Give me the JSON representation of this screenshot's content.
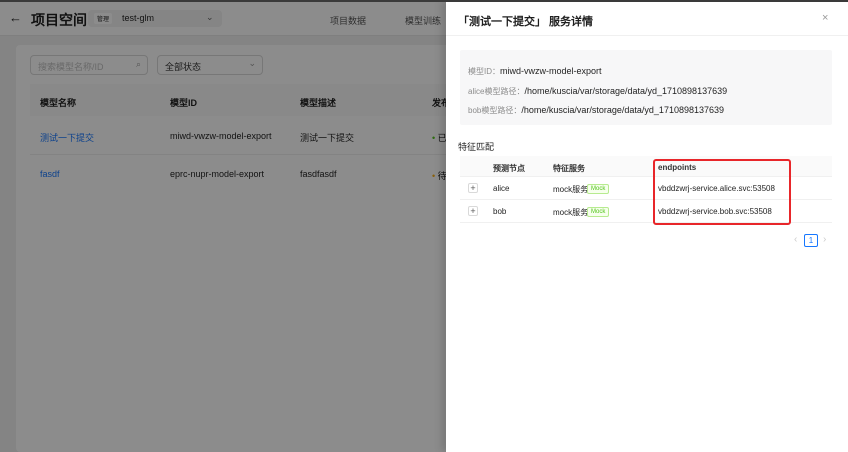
{
  "header": {
    "title": "项目空间",
    "project_tag": "管理",
    "project_name": "test-glm",
    "nav": [
      "项目数据",
      "模型训练"
    ]
  },
  "filters": {
    "search_placeholder": "搜索模型名称/ID",
    "status_select": "全部状态"
  },
  "table": {
    "columns": [
      "模型名称",
      "模型ID",
      "模型描述",
      "发布"
    ],
    "rows": [
      {
        "name": "测试一下提交",
        "id": "miwd-vwzw-model-export",
        "desc": "测试一下提交",
        "status": "已",
        "status_color": "#52c41a"
      },
      {
        "name": "fasdf",
        "id": "eprc-nupr-model-export",
        "desc": "fasdfasdf",
        "status": "待",
        "status_color": "#faad14"
      }
    ]
  },
  "drawer": {
    "title": "「测试一下提交」 服务详情",
    "info": [
      {
        "label": "模型ID：",
        "value": "miwd-vwzw-model-export"
      },
      {
        "label": "alice模型路径：",
        "value": "/home/kuscia/var/storage/data/yd_1710898137639"
      },
      {
        "label": "bob模型路径：",
        "value": "/home/kuscia/var/storage/data/yd_1710898137639"
      }
    ],
    "section_title": "特征匹配",
    "columns": [
      "预测节点",
      "特征服务",
      "endpoints"
    ],
    "rows": [
      {
        "node": "alice",
        "service": "mock服务",
        "tag": "Mock",
        "endpoint": "vbddzwrj-service.alice.svc:53508"
      },
      {
        "node": "bob",
        "service": "mock服务",
        "tag": "Mock",
        "endpoint": "vbddzwrj-service.bob.svc:53508"
      }
    ],
    "page": "1"
  }
}
